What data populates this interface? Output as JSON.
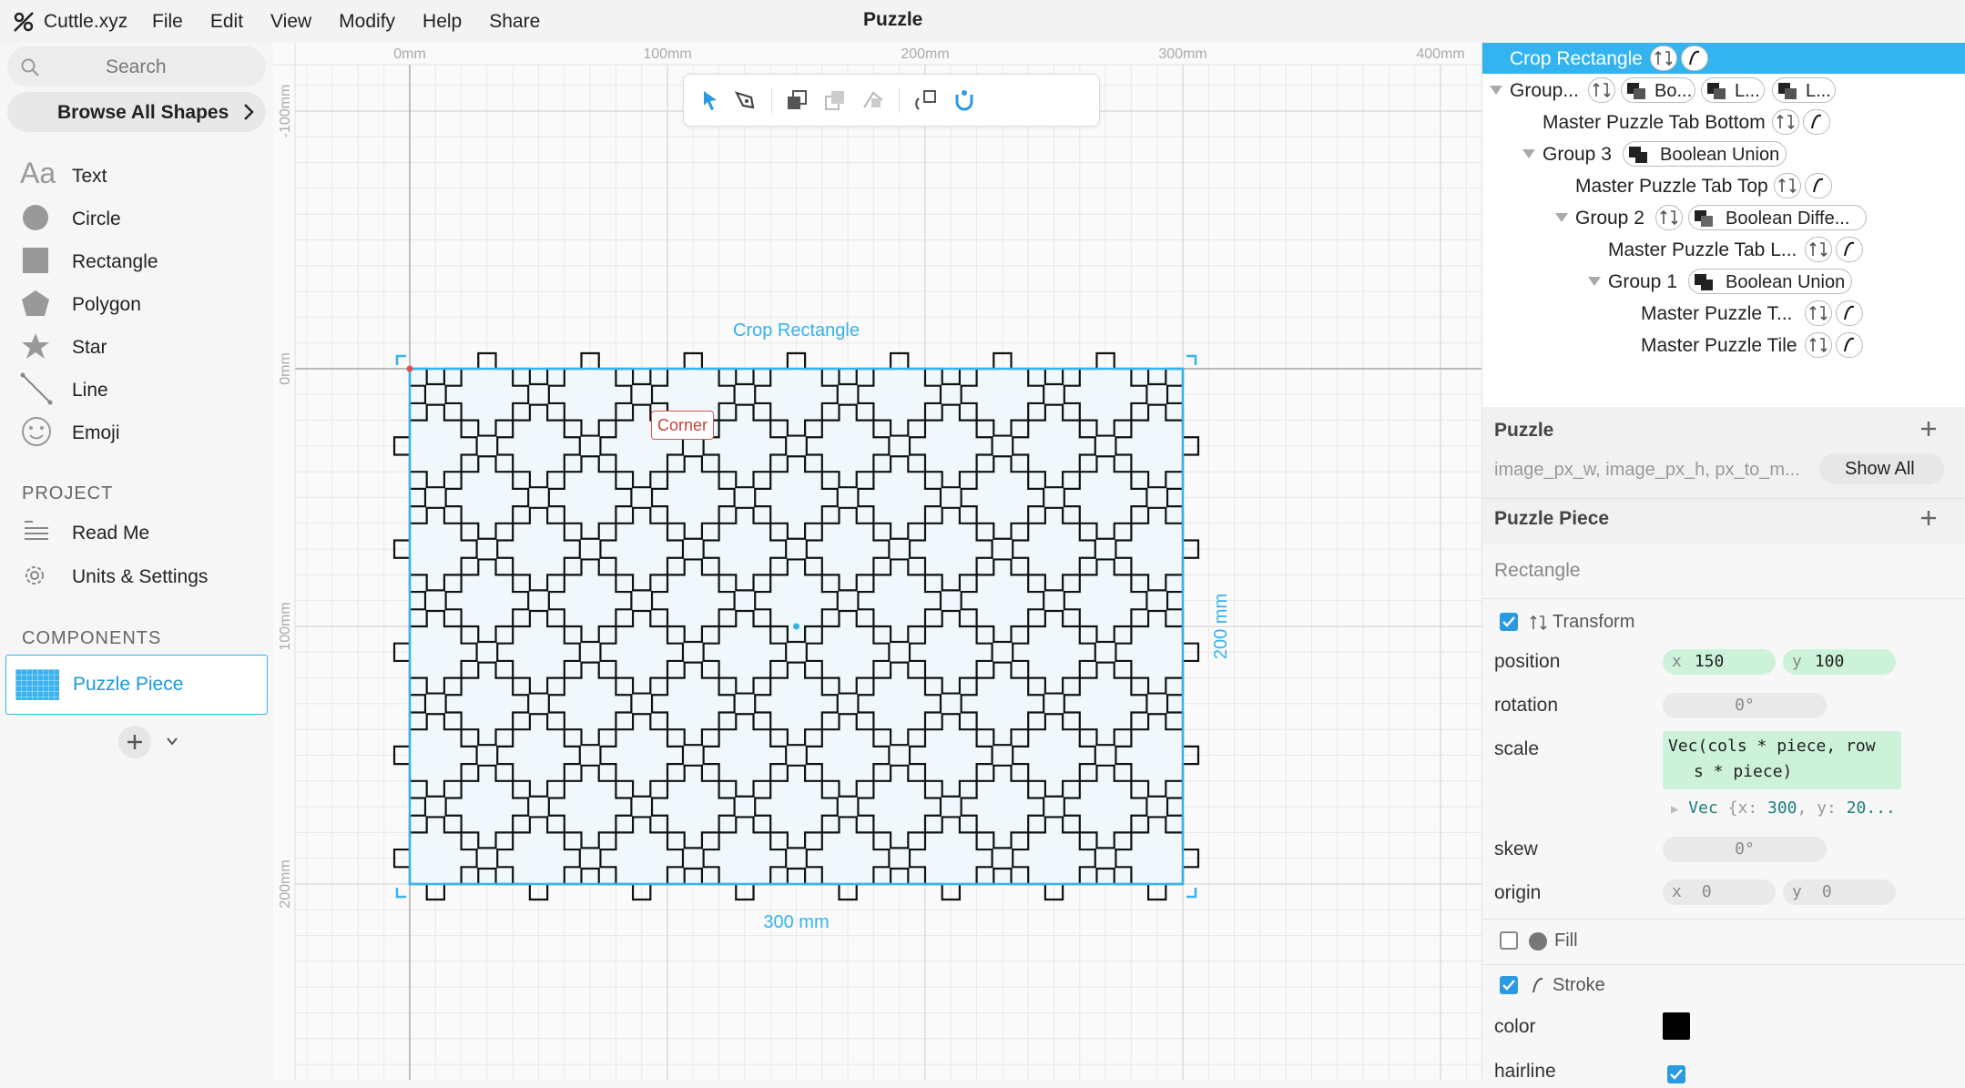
{
  "app": {
    "name": "Cuttle.xyz",
    "document_title": "Puzzle"
  },
  "menu": {
    "items": [
      "File",
      "Edit",
      "View",
      "Modify",
      "Help",
      "Share"
    ]
  },
  "sidebar": {
    "search_placeholder": "Search",
    "browse_label": "Browse All Shapes",
    "shapes": [
      {
        "label": "Text",
        "icon": "text-icon"
      },
      {
        "label": "Circle",
        "icon": "circle-icon"
      },
      {
        "label": "Rectangle",
        "icon": "rectangle-icon"
      },
      {
        "label": "Polygon",
        "icon": "polygon-icon"
      },
      {
        "label": "Star",
        "icon": "star-icon"
      },
      {
        "label": "Line",
        "icon": "line-icon"
      },
      {
        "label": "Emoji",
        "icon": "emoji-icon"
      }
    ],
    "project_title": "PROJECT",
    "project_items": [
      {
        "label": "Read Me",
        "icon": "readme-icon"
      },
      {
        "label": "Units & Settings",
        "icon": "gear-icon"
      }
    ],
    "components_title": "COMPONENTS",
    "component": {
      "label": "Puzzle Piece"
    }
  },
  "canvas": {
    "ruler_x_labels": [
      "0mm",
      "100mm",
      "200mm",
      "300mm",
      "400mm"
    ],
    "ruler_y_labels": [
      "-100mm",
      "0mm",
      "100mm",
      "200mm"
    ],
    "selection_label": "Crop Rectangle",
    "width_label": "300 mm",
    "height_label": "200 mm",
    "corner_tag": "Corner",
    "tools": [
      "pointer-icon",
      "pen-icon",
      "bring-front-icon",
      "send-back-icon",
      "flip-icon",
      "rotate-icon",
      "magnet-icon"
    ],
    "puzzle": {
      "columns": 15,
      "rows": 10,
      "selection_color": "#33b3ef",
      "piece_fill": "#f0f8fc"
    }
  },
  "tree": {
    "rows": [
      {
        "label": "Crop Rectangle",
        "selected": true
      },
      {
        "label": "Group...",
        "chips": [
          "Bo...",
          "L...",
          "L..."
        ]
      },
      {
        "label": "Master Puzzle Tab Bottom"
      },
      {
        "label": "Group 3",
        "chip": "Boolean Union"
      },
      {
        "label": "Master Puzzle Tab Top"
      },
      {
        "label": "Group 2",
        "chip": "Boolean Diffe..."
      },
      {
        "label": "Master Puzzle Tab L..."
      },
      {
        "label": "Group 1",
        "chip": "Boolean Union"
      },
      {
        "label": "Master Puzzle T..."
      },
      {
        "label": "Master Puzzle Tile"
      }
    ]
  },
  "inspector": {
    "puzzle_title": "Puzzle",
    "puzzle_params": "image_px_w, image_px_h, px_to_m...",
    "show_all_label": "Show All",
    "puzzle_piece_title": "Puzzle Piece",
    "shape_type": "Rectangle",
    "transform_label": "Transform",
    "position_label": "position",
    "position_x_axis": "x",
    "position_x": "150",
    "position_y_axis": "y",
    "position_y": "100",
    "rotation_label": "rotation",
    "rotation_value": "0°",
    "scale_label": "scale",
    "scale_expr_line1": "Vec(cols * piece, row",
    "scale_expr_line2": "s * piece)",
    "scale_result_type": "Vec",
    "scale_result_rest": "{x: ",
    "scale_result_x": "300",
    "scale_result_mid": ", y: ",
    "scale_result_y": "20...",
    "skew_label": "skew",
    "skew_value": "0°",
    "origin_label": "origin",
    "origin_x_axis": "x",
    "origin_x": "0",
    "origin_y_axis": "y",
    "origin_y": "0",
    "fill_label": "Fill",
    "stroke_label": "Stroke",
    "color_label": "color",
    "color_value": "#000000",
    "hairline_label": "hairline"
  }
}
